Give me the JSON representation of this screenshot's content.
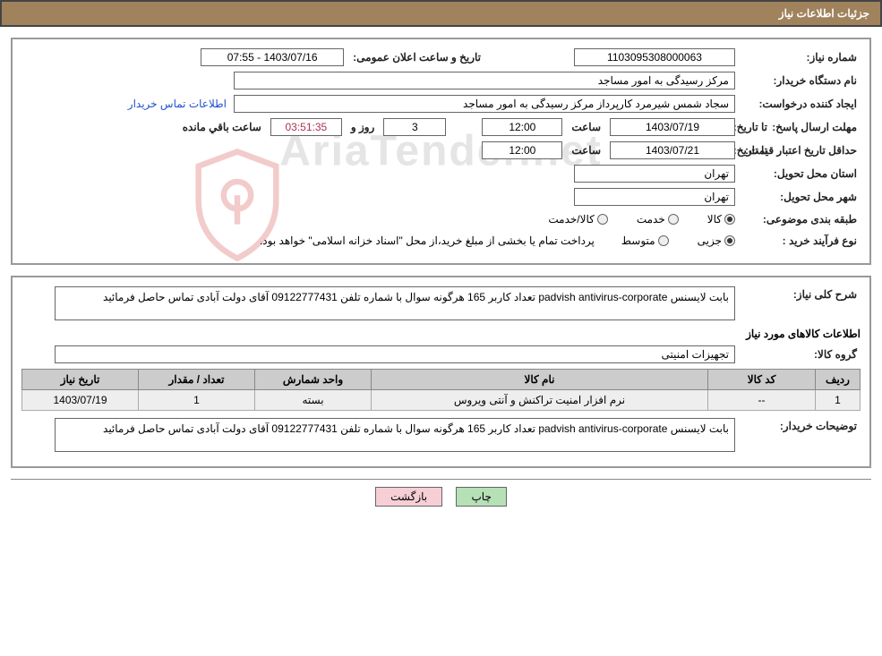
{
  "header": {
    "title": "جزئیات اطلاعات نیاز"
  },
  "row_num": {
    "label": "شماره نیاز:",
    "value": "1103095308000063",
    "date_label": "تاریخ و ساعت اعلان عمومی:",
    "date_value": "1403/07/16 - 07:55"
  },
  "buyer_org": {
    "label": "نام دستگاه خریدار:",
    "value": "مرکز رسیدگی به امور مساجد"
  },
  "requester": {
    "label": "ایجاد کننده درخواست:",
    "value": "سجاد شمس شیرمرد کارپرداز مرکز رسیدگی به امور مساجد",
    "link": "اطلاعات تماس خریدار"
  },
  "deadline": {
    "label": "مهلت ارسال پاسخ:",
    "to": "تا تاریخ:",
    "date": "1403/07/19",
    "time_lbl": "ساعت",
    "time": "12:00",
    "days": "3",
    "days_lbl": "روز و",
    "remain": "03:51:35",
    "remain_lbl": "ساعت باقي مانده"
  },
  "validity": {
    "label": "حداقل تاریخ اعتبار قیمت:",
    "to": "تا تاریخ:",
    "date": "1403/07/21",
    "time_lbl": "ساعت",
    "time": "12:00"
  },
  "province": {
    "label": "استان محل تحویل:",
    "value": "تهران"
  },
  "city": {
    "label": "شهر محل تحویل:",
    "value": "تهران"
  },
  "category": {
    "label": "طبقه بندی موضوعی:",
    "opts": {
      "a": "کالا",
      "b": "خدمت",
      "c": "کالا/خدمت"
    }
  },
  "purchase_type": {
    "label": "نوع فرآیند خرید :",
    "opts": {
      "a": "جزیی",
      "b": "متوسط"
    },
    "note": "پرداخت تمام یا بخشی از مبلغ خرید،از محل \"اسناد خزانه اسلامی\" خواهد بود."
  },
  "need_desc": {
    "label": "شرح کلی نیاز:",
    "value": "بابت لایسنس padvish antivirus-corporate تعداد کاربر 165 هرگونه سوال با شماره تلفن 09122777431 آقای دولت آبادی تماس حاصل فرمائید"
  },
  "goods_info_title": "اطلاعات کالاهای مورد نیاز",
  "goods_group": {
    "label": "گروه کالا:",
    "value": "تجهیزات امنیتی"
  },
  "table": {
    "headers": {
      "row": "ردیف",
      "code": "کد کالا",
      "name": "نام کالا",
      "unit": "واحد شمارش",
      "qty": "تعداد / مقدار",
      "date": "تاریخ نیاز"
    },
    "rows": [
      {
        "row": "1",
        "code": "--",
        "name": "نرم افزار امنیت تراکنش و آنتی ویروس",
        "unit": "بسته",
        "qty": "1",
        "date": "1403/07/19"
      }
    ]
  },
  "buyer_notes": {
    "label": "توضیحات خریدار:",
    "value": "بابت لایسنس padvish antivirus-corporate تعداد کاربر 165 هرگونه سوال با شماره تلفن 09122777431 آقای دولت آبادی تماس حاصل فرمائید"
  },
  "footer": {
    "print": "چاپ",
    "back": "بازگشت"
  },
  "watermark": "AriaTender.net"
}
